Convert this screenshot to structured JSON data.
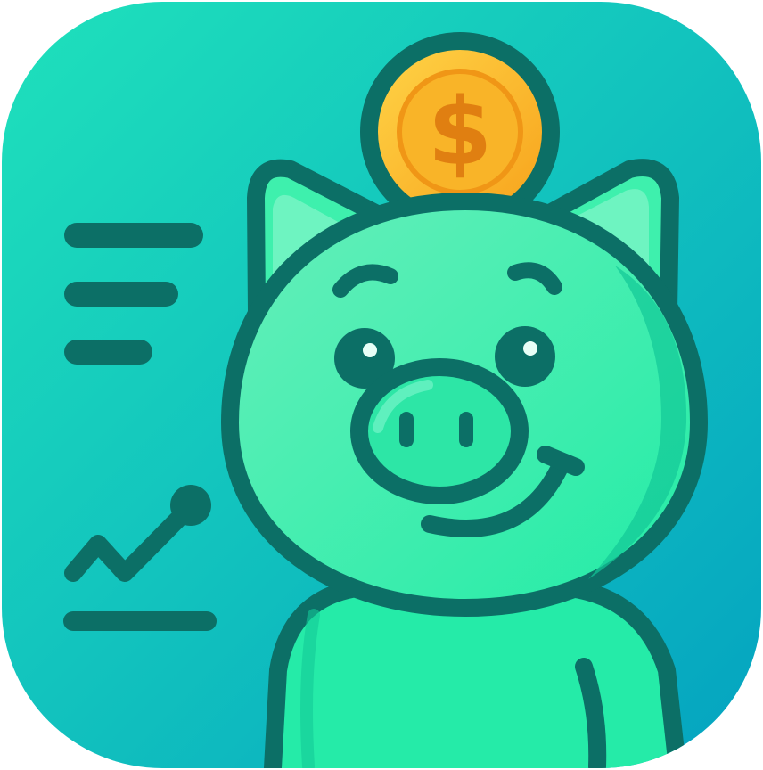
{
  "app_icon": {
    "coin_symbol": "$",
    "colors": {
      "background_top": "#1fe1bb",
      "background_bottom": "#04a3c1",
      "outline": "#0c6f66",
      "pig_light": "#5ff0b6",
      "pig_body": "#27f1a9",
      "pig_shadow": "#10c999",
      "coin_gold": "#fcc132",
      "coin_inner": "#f7a21d",
      "coin_symbol": "#e07f11"
    },
    "icons": [
      "menu-lines-icon",
      "trend-chart-icon",
      "piggy-bank-icon",
      "dollar-coin-icon"
    ]
  }
}
